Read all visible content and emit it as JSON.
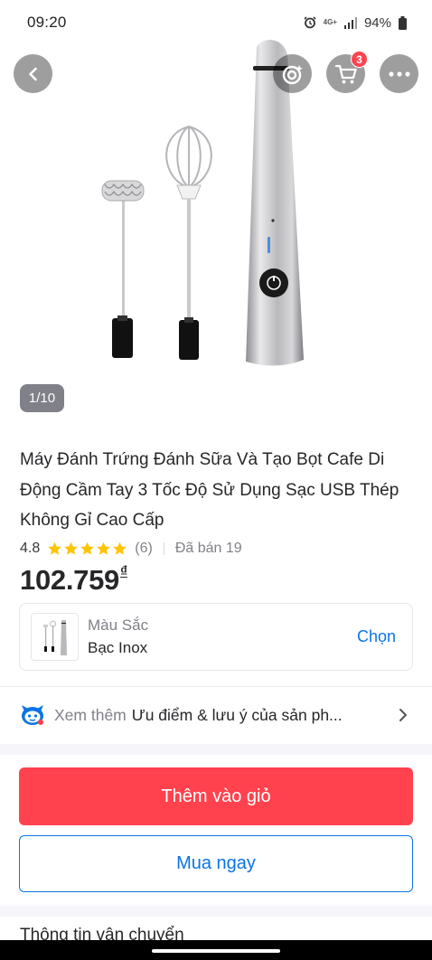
{
  "status_bar": {
    "time": "09:20",
    "network": "4G+",
    "battery": "94%"
  },
  "gallery": {
    "counter": "1/10",
    "cart_count": "3"
  },
  "product": {
    "title": "Máy Đánh Trứng Đánh Sữa Và Tạo Bọt Cafe Di Động Cầm Tay 3 Tốc Độ Sử Dụng Sạc USB Thép Không Gỉ Cao Cấp",
    "rating": "4.8",
    "stars": 5,
    "rating_count": "(6)",
    "sold": "Đã bán 19",
    "price": "102.759",
    "currency": "₫"
  },
  "variant": {
    "label": "Màu Sắc",
    "value": "Bạc Inox",
    "choose": "Chọn"
  },
  "advice": {
    "prefix": "Xem thêm",
    "text": "Ưu điểm & lưu ý của sản ph..."
  },
  "actions": {
    "add_to_cart": "Thêm vào giỏ",
    "buy_now": "Mua ngay"
  },
  "shipping": {
    "title": "Thông tin vận chuyển"
  },
  "colors": {
    "primary_red": "#ff424e",
    "primary_blue": "#0b74e5",
    "star_yellow": "#ffc400"
  }
}
